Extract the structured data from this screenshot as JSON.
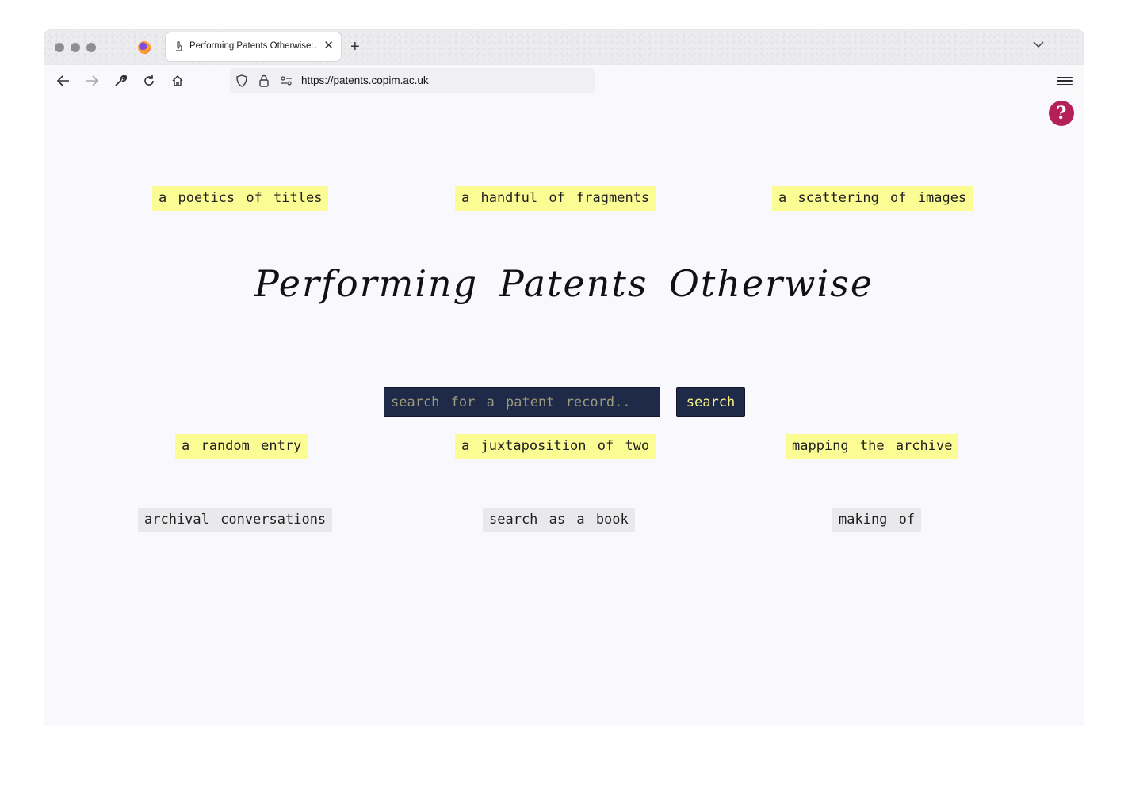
{
  "browser": {
    "tab": {
      "title": "Performing Patents Otherwise: A",
      "favicon": "microscope-icon"
    },
    "url": "https://patents.copim.ac.uk"
  },
  "page": {
    "title": "Performing Patents Otherwise",
    "help_label": "?",
    "top_links": [
      "a poetics of titles",
      "a handful of fragments",
      "a scattering of images"
    ],
    "search": {
      "placeholder": "search for a patent record..",
      "value": "",
      "button_label": "search"
    },
    "middle_links": [
      "a random entry",
      "a juxtaposition of two",
      "mapping the archive"
    ],
    "bottom_links": [
      "archival conversations",
      "search as a book",
      "making of"
    ]
  },
  "colors": {
    "chip_yellow": "#fbfc94",
    "chip_grey": "#e9e9ec",
    "search_bg": "#1e2a47",
    "search_button_text": "#f6f28a",
    "help_bg": "#b3205a"
  }
}
